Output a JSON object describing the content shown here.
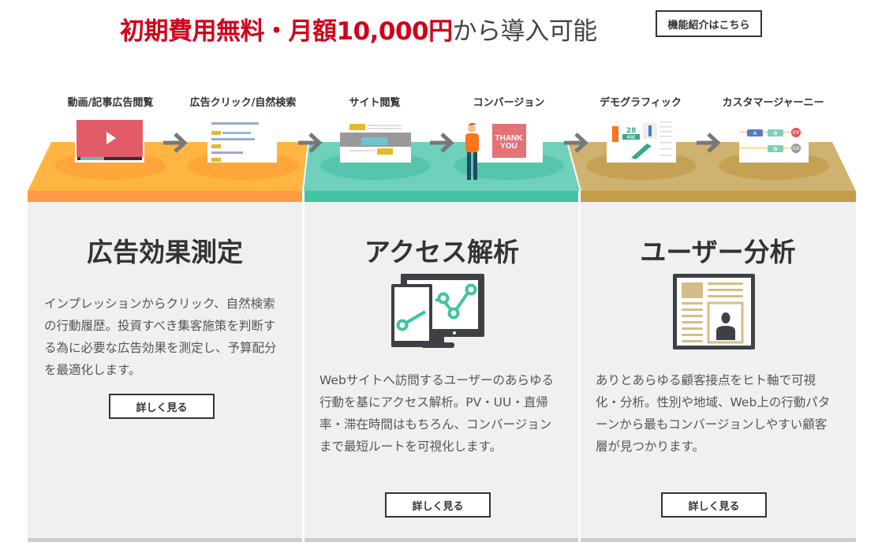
{
  "header": {
    "headline_red": "初期費用無料・月額10,000円",
    "headline_gray": "から導入可能",
    "feature_button": "機能紹介はこちら"
  },
  "steps": [
    "動画/記事広告閲覧",
    "広告クリック/自然検索",
    "サイト閲覧",
    "コンバージョン",
    "デモグラフィック",
    "カスタマージャーニー"
  ],
  "illustrations": {
    "thank_you": "THANK YOU",
    "age_number": "28",
    "age_label": "AGE",
    "journey": [
      "A",
      "B",
      "CV",
      "B",
      "CV"
    ]
  },
  "colors": {
    "orange": "#ffb542",
    "green": "#6fd1bb",
    "gold": "#cfb26f",
    "red_accent": "#d0021b"
  },
  "panels": [
    {
      "title": "広告効果測定",
      "desc": "インプレッションからクリック、自然検索の行動履歴。投資すべき集客施策を判断する為に必要な広告効果を測定し、予算配分を最適化します。",
      "button": "詳しく見る"
    },
    {
      "title": "アクセス解析",
      "icon": "devices-chart-icon",
      "desc": "Webサイトへ訪問するユーザーのあらゆる行動を基にアクセス解析。PV・UU・直帰率・滞在時間はもちろん、コンバージョンまで最短ルートを可視化します。",
      "button": "詳しく見る"
    },
    {
      "title": "ユーザー分析",
      "icon": "user-profile-icon",
      "desc": "ありとあらゆる顧客接点をヒト軸で可視化・分析。性別や地域、Web上の行動パターンから最もコンバージョンしやすい顧客層が見つかります。",
      "button": "詳しく見る"
    }
  ]
}
